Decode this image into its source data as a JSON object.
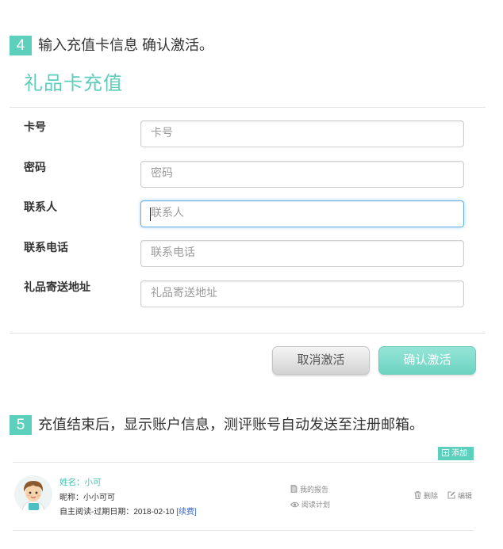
{
  "step4": {
    "number": "4",
    "text": "输入充值卡信息 确认激活。"
  },
  "form": {
    "title": "礼品卡充值",
    "fields": [
      {
        "label": "卡号",
        "placeholder": "卡号"
      },
      {
        "label": "密码",
        "placeholder": "密码"
      },
      {
        "label": "联系人",
        "placeholder": "联系人",
        "focused": true
      },
      {
        "label": "联系电话",
        "placeholder": "联系电话"
      },
      {
        "label": "礼品寄送地址",
        "placeholder": "礼品寄送地址"
      }
    ],
    "cancel_label": "取消激活",
    "confirm_label": "确认激活"
  },
  "step5": {
    "number": "5",
    "text": "充值结束后，显示账户信息，测评账号自动发送至注册邮箱。"
  },
  "account": {
    "add_label": "添加",
    "add_icon": "plus-square-icon",
    "user": {
      "avatar_icon": "cartoon-boy-avatar",
      "name": "姓名：小可",
      "nickname": "昵称：小小可可",
      "expiry": "自主阅读-过期日期：2018-02-10",
      "renew_label": "[续费]"
    },
    "links": [
      {
        "label": "我的报告",
        "icon": "report-icon"
      },
      {
        "label": "阅读计划",
        "icon": "eye-icon"
      }
    ],
    "actions": [
      {
        "label": "删除",
        "icon": "trash-icon"
      },
      {
        "label": "编辑",
        "icon": "edit-icon"
      }
    ]
  },
  "colors": {
    "accent": "#5ccfbd",
    "title": "#5fcdbb",
    "focus_border": "#66afe9",
    "user_name": "#48c2ad",
    "renew_link": "#2f66c2"
  }
}
